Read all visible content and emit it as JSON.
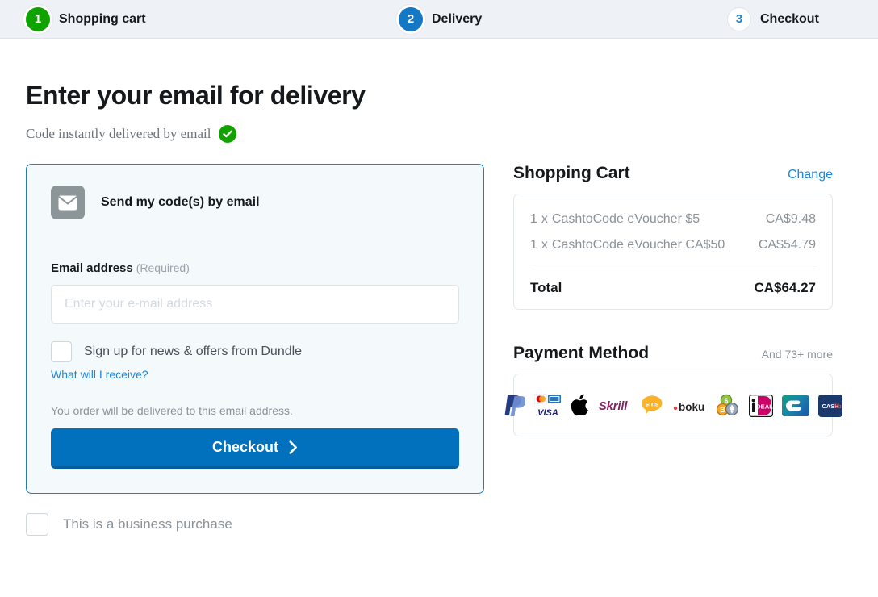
{
  "stepper": {
    "steps": [
      {
        "number": "1",
        "label": "Shopping cart",
        "state": "done"
      },
      {
        "number": "2",
        "label": "Delivery",
        "state": "current"
      },
      {
        "number": "3",
        "label": "Checkout",
        "state": "todo"
      }
    ]
  },
  "page": {
    "title": "Enter your email for delivery",
    "subtitle": "Code instantly delivered by email"
  },
  "delivery_card": {
    "method_label": "Send my code(s) by email",
    "email_label": "Email address",
    "email_required_note": "(Required)",
    "email_placeholder": "Enter your e-mail address",
    "email_value": "",
    "newsletter_label": "Sign up for news & offers from Dundle",
    "newsletter_link": "What will I receive?",
    "order_note": "You order will be delivered to this email address.",
    "checkout_button": "Checkout"
  },
  "business": {
    "label": "This is a business purchase"
  },
  "cart": {
    "title": "Shopping Cart",
    "change_label": "Change",
    "items": [
      {
        "qty": "1",
        "mult": "x",
        "name": "CashtoCode eVoucher $5",
        "price": "CA$9.48"
      },
      {
        "qty": "1",
        "mult": "x",
        "name": "CashtoCode eVoucher CA$50",
        "price": "CA$54.79"
      }
    ],
    "total_label": "Total",
    "total_value": "CA$64.27"
  },
  "payment": {
    "title": "Payment Method",
    "more_label": "And 73+ more",
    "methods": [
      "paypal-icon",
      "mastercard-amex-visa-icon",
      "apple-pay-icon",
      "skrill-icon",
      "sms-icon",
      "boku-icon",
      "crypto-icon",
      "ideal-icon",
      "cb-icon",
      "cashlib-icon"
    ]
  },
  "colors": {
    "accent_blue": "#0271bd",
    "link_blue": "#1b87dc",
    "success_green": "#10a300",
    "card_border": "#1a7fc4",
    "card_bg": "#f4f9fc",
    "muted_text": "#8a9298",
    "header_bg": "#eef2f6"
  }
}
